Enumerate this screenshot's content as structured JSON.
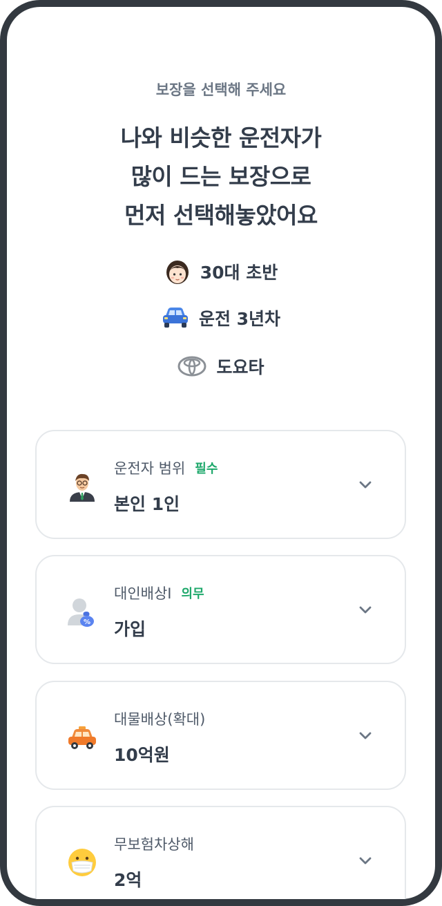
{
  "header": {
    "eyebrow": "보장을 선택해 주세요",
    "headline_lines": [
      "나와 비슷한 운전자가",
      "많이 드는 보장으로",
      "먼저 선택해놓았어요"
    ]
  },
  "profile": [
    {
      "icon": "woman-face-icon",
      "text": "30대 초반"
    },
    {
      "icon": "blue-car-icon",
      "text": "운전 3년차"
    },
    {
      "icon": "toyota-logo-icon",
      "text": "도요타"
    }
  ],
  "coverages": [
    {
      "icon": "businessman-icon",
      "label": "운전자 범위",
      "badge": "필수",
      "value": "본인 1인"
    },
    {
      "icon": "person-coin-icon",
      "label": "대인배상I",
      "badge": "의무",
      "value": "가입"
    },
    {
      "icon": "orange-taxi-icon",
      "label": "대물배상(확대)",
      "badge": "",
      "value": "10억원"
    },
    {
      "icon": "mask-face-icon",
      "label": "무보험차상해",
      "badge": "",
      "value": "2억"
    }
  ],
  "colors": {
    "badge": "#1ea86b",
    "bezel": "#333940",
    "card_border": "#e5e8eb",
    "text": "#333d4b"
  }
}
